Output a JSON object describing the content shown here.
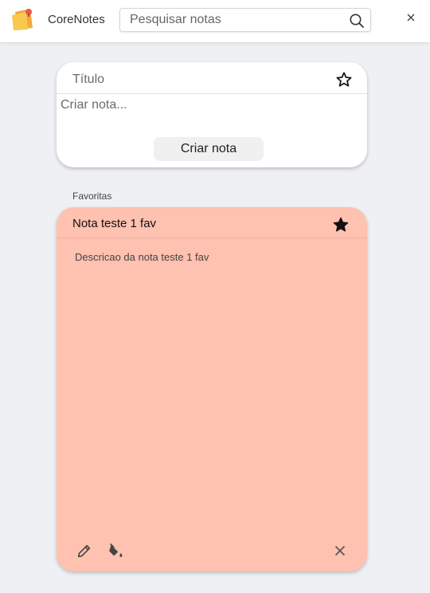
{
  "header": {
    "app_title": "CoreNotes",
    "search_placeholder": "Pesquisar notas"
  },
  "create_note": {
    "title_placeholder": "Título",
    "body_placeholder": "Criar nota...",
    "submit_label": "Criar nota"
  },
  "favorites": {
    "section_label": "Favoritas",
    "notes": [
      {
        "title": "Nota teste 1 fav",
        "description": "Descricao da nota teste 1 fav",
        "color": "#ffc1b0",
        "favorite": true
      }
    ]
  },
  "icons": {
    "logo": "sticky-notes-logo",
    "search": "search-icon",
    "close_app": "close-icon",
    "favorite_off": "star-outline-icon",
    "favorite_on": "star-filled-icon",
    "edit": "pencil-icon",
    "color": "paint-bucket-icon",
    "delete": "close-icon"
  },
  "colors": {
    "page_background": "#eef0f3",
    "card_background": "#ffffff",
    "accent_logo": "#f5c04a"
  }
}
